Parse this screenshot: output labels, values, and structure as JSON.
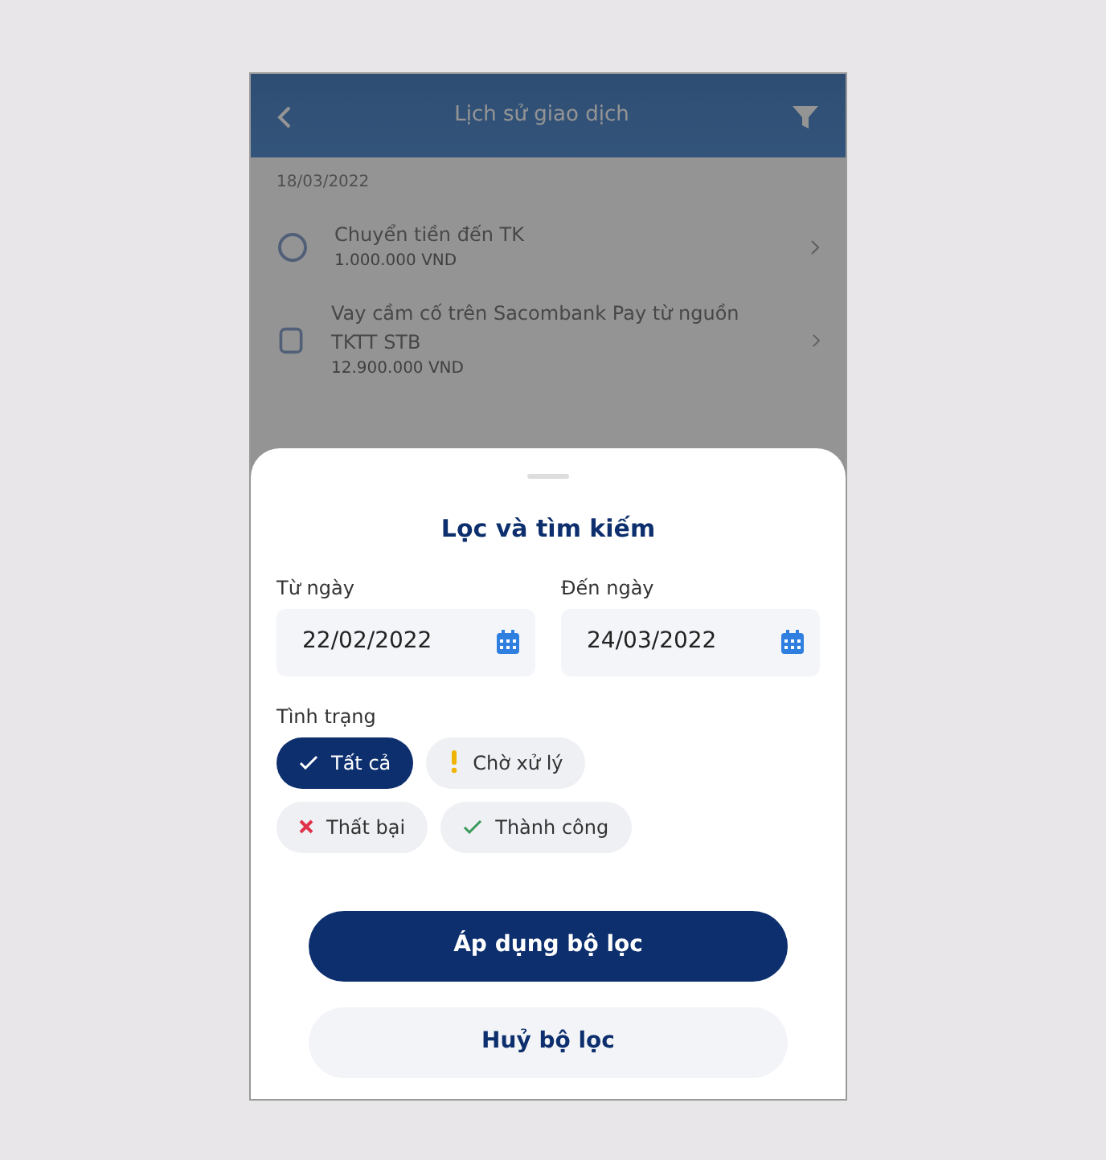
{
  "header": {
    "title": "Lịch sử giao dịch"
  },
  "background_list": {
    "date": "18/03/2022",
    "items": [
      {
        "kind": "transfer",
        "title": "Chuyển tiền đến TK",
        "amount": "1.000.000 VND"
      },
      {
        "kind": "loan",
        "title": "Vay cầm cố trên Sacombank Pay từ nguồn TKTT STB",
        "amount": "12.900.000 VND"
      }
    ]
  },
  "sheet": {
    "title": "Lọc và tìm kiếm",
    "dates": [
      {
        "label": "Từ ngày",
        "value": "22/02/2022"
      },
      {
        "label": "Đến ngày",
        "value": "24/03/2022"
      }
    ],
    "status_label": "Tình trạng",
    "statuses": [
      {
        "kind": "all",
        "label": "Tất cả",
        "selected": true
      },
      {
        "kind": "pending",
        "label": "Chờ xử lý",
        "selected": false
      },
      {
        "kind": "failed",
        "label": "Thất bại",
        "selected": false
      },
      {
        "kind": "success",
        "label": "Thành công",
        "selected": false
      }
    ],
    "buttons": [
      {
        "kind": "primary",
        "label": "Áp dụng bộ lọc"
      },
      {
        "kind": "secondary",
        "label": "Huỷ bộ lọc"
      }
    ]
  }
}
